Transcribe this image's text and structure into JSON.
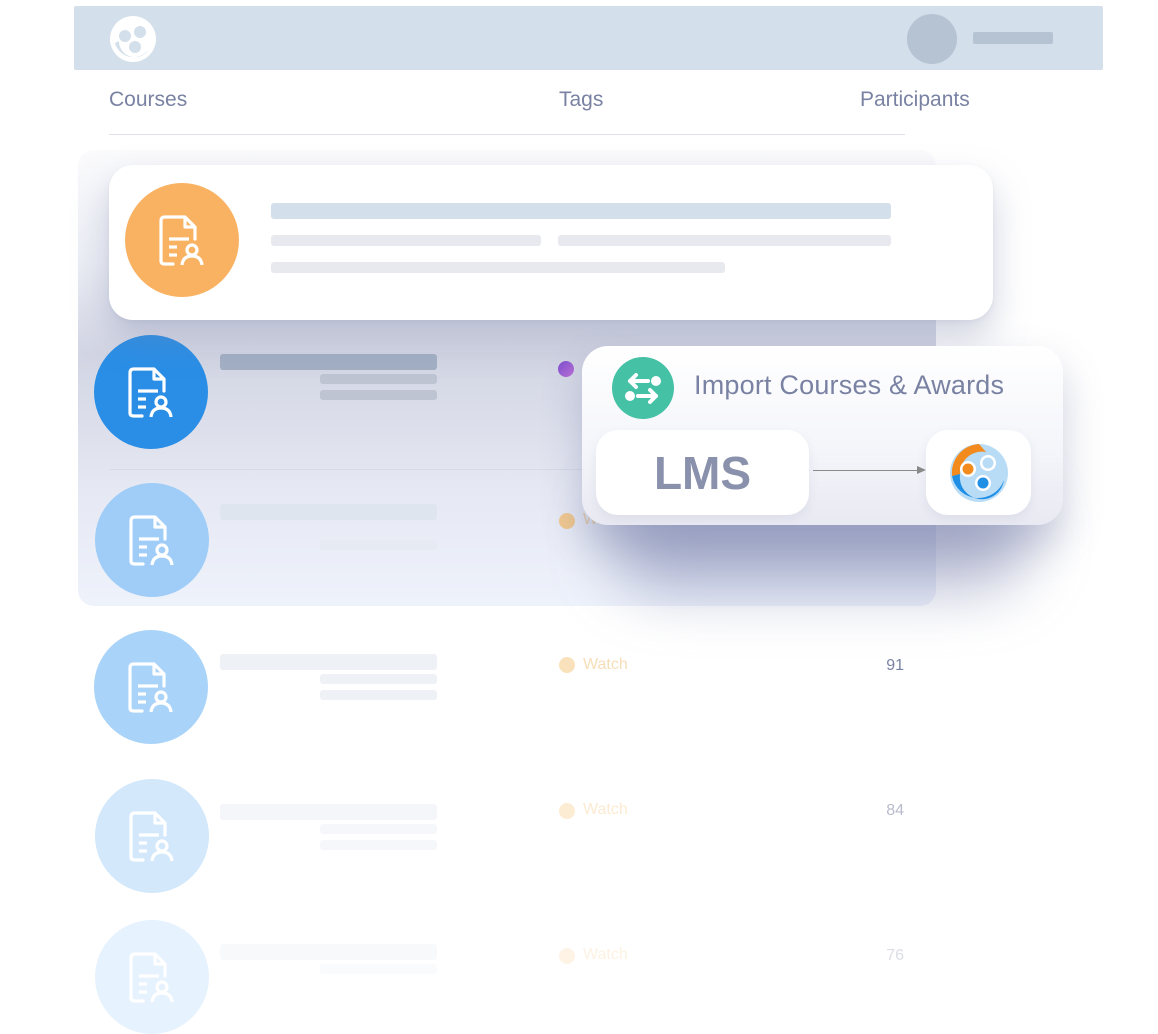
{
  "header": {
    "logo": "app-logo",
    "avatar": "user-avatar"
  },
  "columns": {
    "courses": "Courses",
    "tags": "Tags",
    "participants": "Participants"
  },
  "rows": [
    {
      "tag": "",
      "tag_color": "#9b59d0",
      "participants": ""
    },
    {
      "tag": "Watch",
      "tag_color": "#f2c98f",
      "participants": ""
    },
    {
      "tag": "Watch",
      "tag_color": "#f6d9a8",
      "participants": "91"
    },
    {
      "tag": "Watch",
      "tag_color": "#fbe8cc",
      "participants": "84"
    },
    {
      "tag": "Watch",
      "tag_color": "#fdf1e0",
      "participants": "76"
    }
  ],
  "import_modal": {
    "title": "Import Courses & Awards",
    "source_label": "LMS",
    "icon": "swap-arrows-icon",
    "accent": "#45c1a6"
  },
  "colors": {
    "featured_icon": "#f8b262",
    "active_icon": "#2a8ee6",
    "header_bar": "#d3dfea"
  }
}
